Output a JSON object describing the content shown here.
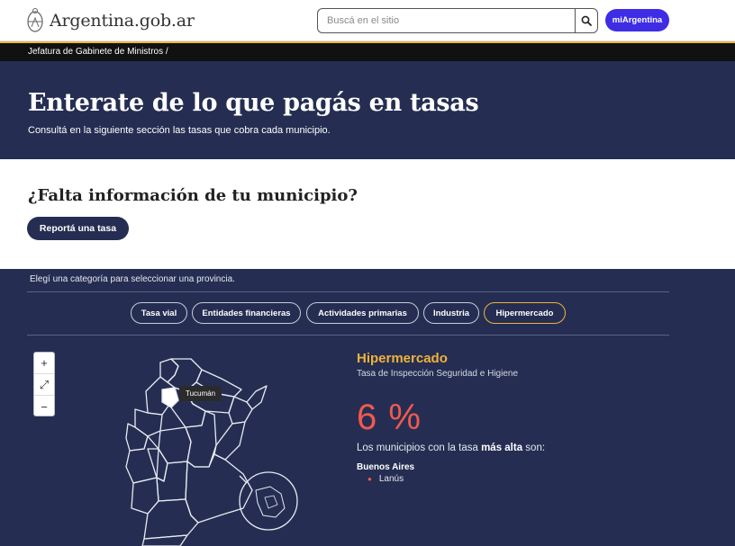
{
  "header": {
    "logo_text": "Argentina.gob.ar",
    "search_placeholder": "Buscá en el sitio",
    "search_icon": "search-icon",
    "account_button": "miArgentina"
  },
  "breadcrumb": {
    "path": "Jefatura de Gabinete de Ministros /"
  },
  "hero": {
    "title": "Enterate de lo que pagás en tasas",
    "subtitle": "Consultá en la siguiente sección las tasas que cobra cada municipio."
  },
  "info": {
    "title": "¿Falta información de tu municipio?",
    "report_button": "Reportá una tasa"
  },
  "panel": {
    "hint": "Elegí una categoría para seleccionar una provincia.",
    "categories": [
      {
        "label": "Tasa vial",
        "active": false
      },
      {
        "label": "Entidades financieras",
        "active": false
      },
      {
        "label": "Actividades primarias",
        "active": false
      },
      {
        "label": "Industria",
        "active": false
      },
      {
        "label": "Hipermercado",
        "active": true
      }
    ],
    "zoom": {
      "in": "+",
      "fullscreen": "⤢",
      "out": "−"
    },
    "map_tooltip": "Tucumán",
    "selected": {
      "category": "Hipermercado",
      "tax_name": "Tasa de Inspección Seguridad e Higiene",
      "rate": "6",
      "rate_unit": "%",
      "highest_label_prefix": "Los municipios con la tasa ",
      "highest_label_bold": "más alta",
      "highest_label_suffix": " son:",
      "province": "Buenos Aires",
      "municipalities": [
        "Lanús"
      ]
    }
  },
  "colors": {
    "navy": "#252e52",
    "accent_gold": "#f0b23b",
    "accent_red": "#f05a4f",
    "primary_purple": "#3e2de5"
  }
}
